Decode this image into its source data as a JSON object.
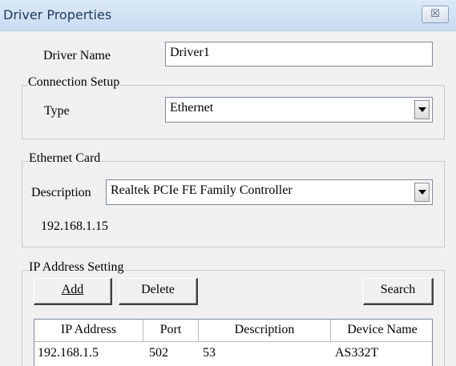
{
  "window": {
    "title": "Driver Properties",
    "close_glyph": "☒"
  },
  "driver_name": {
    "label": "Driver Name",
    "value": "Driver1"
  },
  "connection_setup": {
    "legend": "Connection Setup",
    "type_label": "Type",
    "type_value": "Ethernet"
  },
  "ethernet_card": {
    "legend": "Ethernet Card",
    "description_label": "Description",
    "description_value": "Realtek PCIe FE Family Controller",
    "ip": "192.168.1.15"
  },
  "ip_address_setting": {
    "legend": "IP Address Setting",
    "add_label": "Add",
    "delete_label": "Delete",
    "search_label": "Search",
    "columns": [
      "IP Address",
      "Port",
      "Description",
      "Device Name"
    ],
    "rows": [
      {
        "ip": "192.168.1.5",
        "port": "502",
        "description": "53",
        "device_name": "AS332T"
      }
    ]
  }
}
